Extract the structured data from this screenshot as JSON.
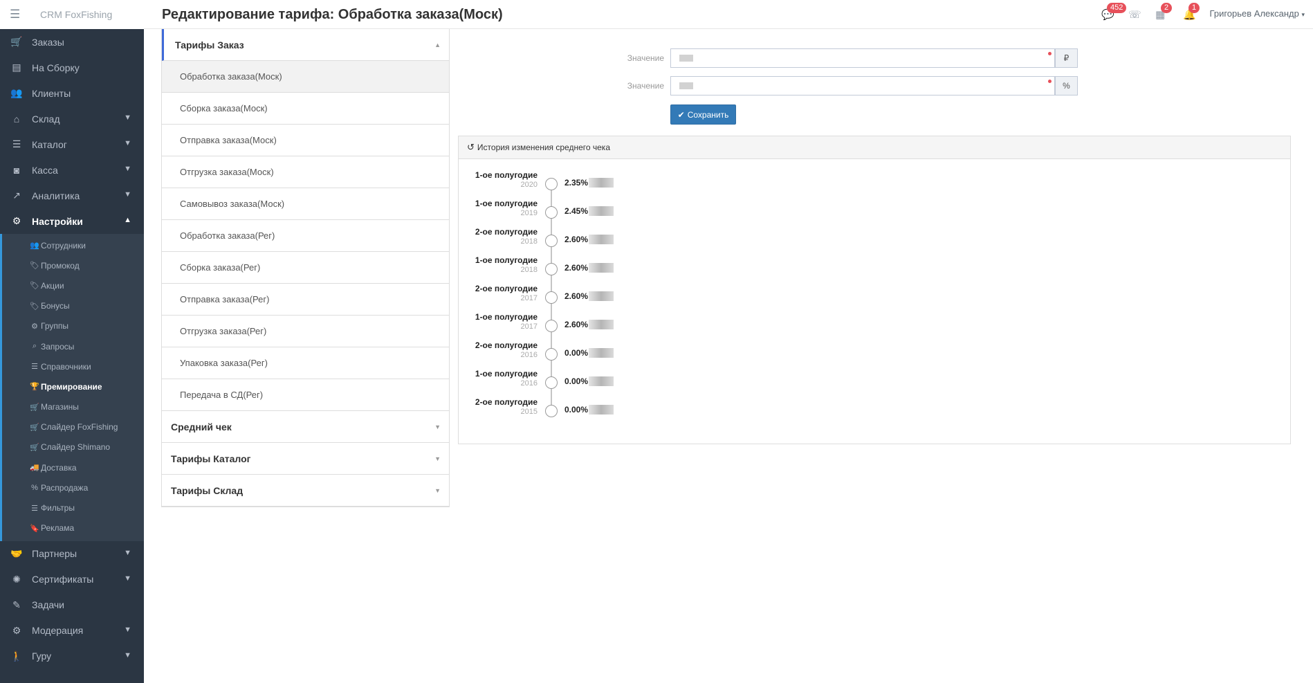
{
  "app": {
    "brand": "CRM FoxFishing"
  },
  "header": {
    "title": "Редактирование тарифа: Обработка заказа(Моск)",
    "messages_badge": "452",
    "calendar_badge": "2",
    "notifications_badge": "1",
    "user_name": "Григорьев Александр"
  },
  "sidebar": {
    "items": [
      {
        "label": "Заказы",
        "icon": "shopping-cart-icon",
        "glyph": "🛒",
        "has_chevron": false
      },
      {
        "label": "На Сборку",
        "icon": "archive-icon",
        "glyph": "▤",
        "has_chevron": false
      },
      {
        "label": "Клиенты",
        "icon": "users-icon",
        "glyph": "👥",
        "has_chevron": false
      },
      {
        "label": "Склад",
        "icon": "home-icon",
        "glyph": "⌂",
        "has_chevron": true
      },
      {
        "label": "Каталог",
        "icon": "list-icon",
        "glyph": "☰",
        "has_chevron": true
      },
      {
        "label": "Касса",
        "icon": "money-icon",
        "glyph": "◙",
        "has_chevron": true
      },
      {
        "label": "Аналитика",
        "icon": "chart-line-icon",
        "glyph": "↗",
        "has_chevron": true
      },
      {
        "label": "Настройки",
        "icon": "cogs-icon",
        "glyph": "⚙",
        "has_chevron": true,
        "active": true
      }
    ],
    "settings_submenu": [
      {
        "label": "Сотрудники",
        "icon": "users-icon",
        "glyph": "👥"
      },
      {
        "label": "Промокод",
        "icon": "tags-icon",
        "glyph": "🏷"
      },
      {
        "label": "Акции",
        "icon": "tags-icon",
        "glyph": "🏷"
      },
      {
        "label": "Бонусы",
        "icon": "tags-icon",
        "glyph": "🏷"
      },
      {
        "label": "Группы",
        "icon": "gear-icon",
        "glyph": "⚙"
      },
      {
        "label": "Запросы",
        "icon": "search-icon",
        "glyph": "⌕"
      },
      {
        "label": "Справочники",
        "icon": "list-icon",
        "glyph": "☰"
      },
      {
        "label": "Премирование",
        "icon": "trophy-icon",
        "glyph": "🏆",
        "active": true
      },
      {
        "label": "Магазины",
        "icon": "shopping-cart-icon",
        "glyph": "🛒"
      },
      {
        "label": "Слайдер FoxFishing",
        "icon": "shopping-cart-icon",
        "glyph": "🛒"
      },
      {
        "label": "Слайдер Shimano",
        "icon": "shopping-cart-icon",
        "glyph": "🛒"
      },
      {
        "label": "Доставка",
        "icon": "truck-icon",
        "glyph": "🚚"
      },
      {
        "label": "Распродажа",
        "icon": "percent-icon",
        "glyph": "%"
      },
      {
        "label": "Фильтры",
        "icon": "list-icon",
        "glyph": "☰"
      },
      {
        "label": "Реклама",
        "icon": "bookmark-icon",
        "glyph": "🔖"
      }
    ],
    "bottom_items": [
      {
        "label": "Партнеры",
        "icon": "handshake-icon",
        "glyph": "🤝",
        "has_chevron": true
      },
      {
        "label": "Сертификаты",
        "icon": "certificate-icon",
        "glyph": "✺",
        "has_chevron": true
      },
      {
        "label": "Задачи",
        "icon": "tasks-icon",
        "glyph": "✎",
        "has_chevron": false
      },
      {
        "label": "Модерация",
        "icon": "cogs-icon",
        "glyph": "⚙",
        "has_chevron": true
      },
      {
        "label": "Гуру",
        "icon": "walking-icon",
        "glyph": "🚶",
        "has_chevron": true
      }
    ]
  },
  "tariffs": {
    "groups": [
      {
        "title": "Тарифы Заказ",
        "open": true,
        "items": [
          "Обработка заказа(Моск)",
          "Сборка заказа(Моск)",
          "Отправка заказа(Моск)",
          "Отгрузка заказа(Моск)",
          "Самовывоз заказа(Моск)",
          "Обработка заказа(Рег)",
          "Сборка заказа(Рег)",
          "Отправка заказа(Рег)",
          "Отгрузка заказа(Рег)",
          "Упаковка заказа(Рег)",
          "Передача в СД(Рег)"
        ],
        "active_item": "Обработка заказа(Моск)"
      },
      {
        "title": "Средний чек",
        "open": false
      },
      {
        "title": "Тарифы Каталог",
        "open": false
      },
      {
        "title": "Тарифы Склад",
        "open": false
      }
    ]
  },
  "form": {
    "field1": {
      "label": "Значение",
      "value": "",
      "addon": "₽"
    },
    "field2": {
      "label": "Значение",
      "value": "",
      "addon": "%"
    },
    "save_label": "Сохранить"
  },
  "history": {
    "title": "История изменения среднего чека",
    "entries": [
      {
        "period": "1-ое полугодие",
        "year": "2020",
        "value": "2.35%"
      },
      {
        "period": "1-ое полугодие",
        "year": "2019",
        "value": "2.45%"
      },
      {
        "period": "2-ое полугодие",
        "year": "2018",
        "value": "2.60%"
      },
      {
        "period": "1-ое полугодие",
        "year": "2018",
        "value": "2.60%"
      },
      {
        "period": "2-ое полугодие",
        "year": "2017",
        "value": "2.60%"
      },
      {
        "period": "1-ое полугодие",
        "year": "2017",
        "value": "2.60%"
      },
      {
        "period": "2-ое полугодие",
        "year": "2016",
        "value": "0.00%"
      },
      {
        "period": "1-ое полугодие",
        "year": "2016",
        "value": "0.00%"
      },
      {
        "period": "2-ое полугодие",
        "year": "2015",
        "value": "0.00%"
      }
    ]
  },
  "colors": {
    "sidebar_bg": "#2b3643",
    "accent": "#3598dc",
    "primary_button": "#337ab7",
    "badge": "#e7505a"
  }
}
